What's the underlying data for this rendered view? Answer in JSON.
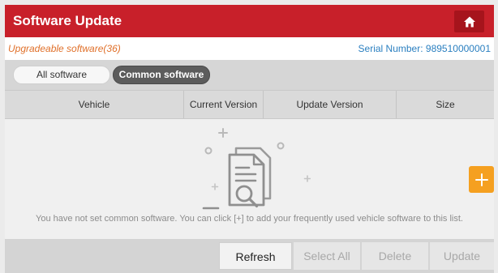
{
  "header": {
    "title": "Software Update",
    "home_icon": "home-icon"
  },
  "info": {
    "upgradeable_text": "Upgradeable software(36)",
    "serial_label": "Serial Number:",
    "serial_value": "989510000001"
  },
  "tabs": [
    {
      "label": "All software",
      "active": false
    },
    {
      "label": "Common software",
      "active": true
    }
  ],
  "table": {
    "columns": [
      "Vehicle",
      "Current Version",
      "Update Version",
      "Size"
    ]
  },
  "empty_state": {
    "icon": "empty-document-icon",
    "message": "You have not set common software. You can click [+] to add your frequently used vehicle software to this list."
  },
  "add_button_icon": "plus-icon",
  "actions": {
    "refresh": "Refresh",
    "select_all": "Select All",
    "delete": "Delete",
    "update": "Update"
  },
  "colors": {
    "title_bar": "#c8202a",
    "home_button": "#a6141c",
    "upgradeable_text": "#e0702a",
    "serial_text": "#2a7fc0",
    "add_button": "#f5a020",
    "active_tab": "#5c5c5c"
  }
}
